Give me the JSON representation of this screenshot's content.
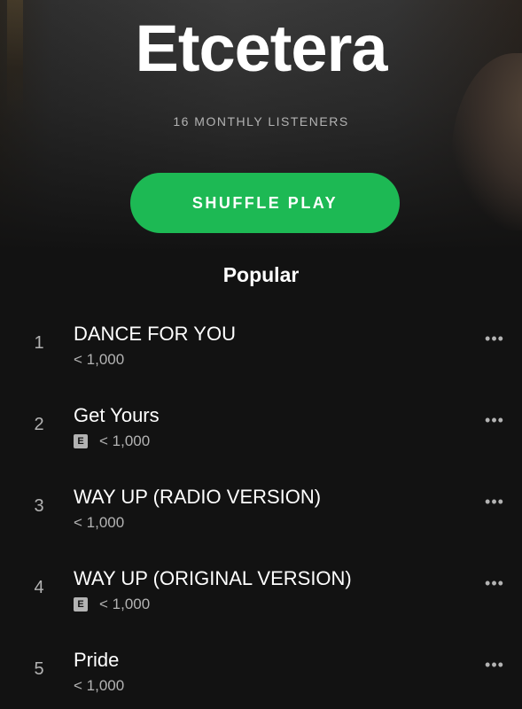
{
  "artist": {
    "name": "Etcetera",
    "monthly_listeners": "16 MONTHLY LISTENERS"
  },
  "actions": {
    "shuffle_label": "SHUFFLE PLAY"
  },
  "popular": {
    "title": "Popular",
    "tracks": [
      {
        "number": "1",
        "title": "DANCE FOR YOU",
        "plays": "< 1,000",
        "explicit": false
      },
      {
        "number": "2",
        "title": "Get Yours",
        "plays": "< 1,000",
        "explicit": true,
        "explicit_label": "E"
      },
      {
        "number": "3",
        "title": "WAY UP (RADIO VERSION)",
        "plays": "< 1,000",
        "explicit": false
      },
      {
        "number": "4",
        "title": "WAY UP (ORIGINAL VERSION)",
        "plays": "< 1,000",
        "explicit": true,
        "explicit_label": "E"
      },
      {
        "number": "5",
        "title": "Pride",
        "plays": "< 1,000",
        "explicit": false
      }
    ]
  },
  "icons": {
    "more": "more-options-icon",
    "explicit": "explicit-badge"
  },
  "colors": {
    "background": "#121212",
    "accent": "#1db954",
    "text_primary": "#ffffff",
    "text_secondary": "#b3b3b3"
  }
}
